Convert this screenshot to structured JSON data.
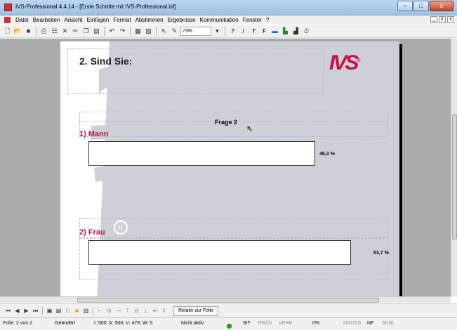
{
  "window": {
    "title": "IVS-Professional 4.4.14 - [Erste Schritte mit IVS-Professional.isf]",
    "minimize": "–",
    "maximize": "□",
    "close": "x"
  },
  "menu": {
    "items": [
      "Datei",
      "Bearbeiten",
      "Ansicht",
      "Einfügen",
      "Format",
      "Abstimmen",
      "Ergebnisse",
      "Kommunikation",
      "Fenster",
      "?"
    ],
    "mdi_minimize": "_",
    "mdi_restore": "ᴇ",
    "mdi_close": "x"
  },
  "toolbar": {
    "zoom": "73%",
    "italic_1": "?",
    "italic_2": "!",
    "italic_3": "T",
    "italic_4": "F"
  },
  "slide": {
    "title": "2. Sind Sie:",
    "logo": "IVS",
    "logo_mark": "®",
    "question": "Frage 2",
    "answers": [
      {
        "label": "1) Mann",
        "percent": "46,3 %",
        "value": 46.3
      },
      {
        "label": "2) Frau",
        "percent": "53,7 %",
        "value": 53.7
      }
    ]
  },
  "bottom_toolbar": {
    "relativ_button": "Relativ zur Folie"
  },
  "status": {
    "folie": "Folie: 2 von 2",
    "changed": "Geändert",
    "values": "I: 500;   A: 500;   V: 479;   W: 0",
    "nicht_aktiv": "Nicht aktiv",
    "sit": "SIT",
    "pras": "PRÄS",
    "verr": "VERR",
    "percent": "0%",
    "gross": "GROSS",
    "nf": "NF",
    "scrl": "SCRL"
  },
  "colors": {
    "accent": "#c0134a",
    "slide_background": "#cdd0d6",
    "workspace": "#ababab"
  }
}
